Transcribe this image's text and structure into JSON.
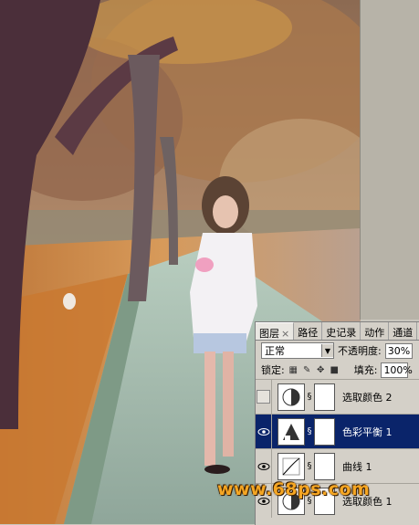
{
  "panel": {
    "tabs": [
      {
        "label": "图层",
        "close": "×"
      },
      {
        "label": "路径"
      },
      {
        "label": "史记录"
      },
      {
        "label": "动作"
      },
      {
        "label": "通道"
      }
    ],
    "blend_mode": "正常",
    "opacity_label": "不透明度:",
    "opacity_value": "30%",
    "lock_label": "锁定:",
    "fill_label": "填充:",
    "fill_value": "100%",
    "layers": [
      {
        "name": "选取颜色 2",
        "visible": false,
        "selected": false,
        "icon": "selective-color-icon"
      },
      {
        "name": "色彩平衡 1",
        "visible": true,
        "selected": true,
        "icon": "color-balance-icon"
      },
      {
        "name": "曲线 1",
        "visible": true,
        "selected": false,
        "icon": "curves-icon"
      },
      {
        "name": "选取颜色 1",
        "visible": true,
        "selected": false,
        "icon": "selective-color-icon"
      }
    ]
  },
  "watermark": "www.68ps.com",
  "colors": {
    "selected_layer": "#0a246a",
    "watermark": "#f5a623"
  }
}
